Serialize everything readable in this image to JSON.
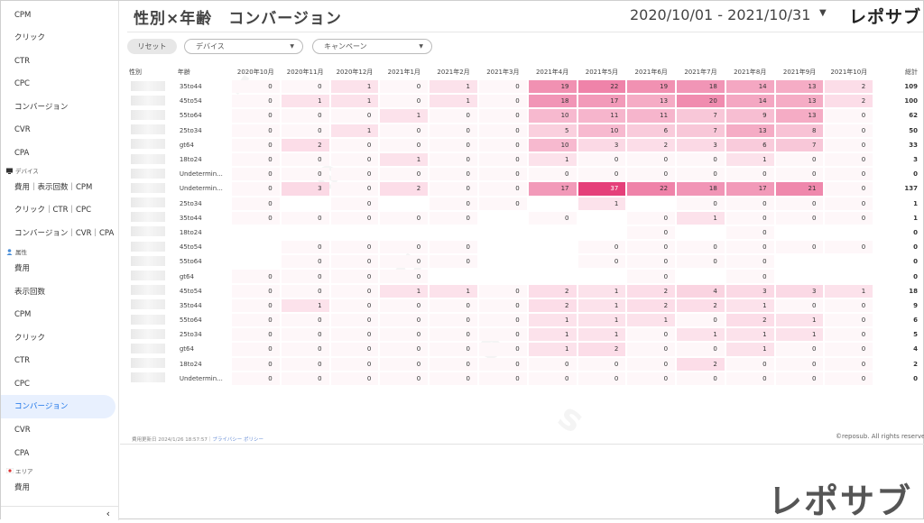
{
  "sidebar": {
    "items": [
      "CPM",
      "クリック",
      "CTR",
      "CPC",
      "コンバージョン",
      "CVR",
      "CPA"
    ],
    "device_section": "デバイス",
    "device_items": [
      "費用｜表示回数｜CPM",
      "クリック｜CTR｜CPC",
      "コンバージョン｜CVR｜CPA"
    ],
    "attr_section": "属性",
    "attr_items": [
      "費用",
      "表示回数",
      "CPM",
      "クリック",
      "CTR",
      "CPC",
      "コンバージョン",
      "CVR",
      "CPA"
    ],
    "area_section": "エリア",
    "area_items": [
      "費用"
    ],
    "collapse_label": "‹"
  },
  "header": {
    "title": "性別×年齢　コンバージョン",
    "date_range": "2020/10/01 - 2021/10/31",
    "date_caret": "▼",
    "brand": "レポサブ"
  },
  "filters": {
    "reset_label": "リセット",
    "device_label": "デバイス",
    "campaign_label": "キャンペーン",
    "caret": "▼"
  },
  "table": {
    "columns": [
      "性別",
      "年齢",
      "2020年10月",
      "2020年11月",
      "2020年12月",
      "2021年1月",
      "2021年2月",
      "2021年3月",
      "2021年4月",
      "2021年5月",
      "2021年6月",
      "2021年7月",
      "2021年8月",
      "2021年9月",
      "2021年10月",
      "総計"
    ],
    "rows": [
      {
        "age": "35to44",
        "values": [
          "0",
          "0",
          "1",
          "0",
          "1",
          "0",
          "19",
          "22",
          "19",
          "18",
          "14",
          "13",
          "2"
        ],
        "total": "109"
      },
      {
        "age": "45to54",
        "values": [
          "0",
          "1",
          "1",
          "0",
          "1",
          "0",
          "18",
          "17",
          "13",
          "20",
          "14",
          "13",
          "2"
        ],
        "total": "100"
      },
      {
        "age": "55to64",
        "values": [
          "0",
          "0",
          "0",
          "1",
          "0",
          "0",
          "10",
          "11",
          "11",
          "7",
          "9",
          "13",
          "0"
        ],
        "total": "62"
      },
      {
        "age": "25to34",
        "values": [
          "0",
          "0",
          "1",
          "0",
          "0",
          "0",
          "5",
          "10",
          "6",
          "7",
          "13",
          "8",
          "0"
        ],
        "total": "50"
      },
      {
        "age": "gt64",
        "values": [
          "0",
          "2",
          "0",
          "0",
          "0",
          "0",
          "10",
          "3",
          "2",
          "3",
          "6",
          "7",
          "0"
        ],
        "total": "33"
      },
      {
        "age": "18to24",
        "values": [
          "0",
          "0",
          "0",
          "1",
          "0",
          "0",
          "1",
          "0",
          "0",
          "0",
          "1",
          "0",
          "0"
        ],
        "total": "3"
      },
      {
        "age": "Undetermin...",
        "values": [
          "0",
          "0",
          "0",
          "0",
          "0",
          "0",
          "0",
          "0",
          "0",
          "0",
          "0",
          "0",
          "0"
        ],
        "total": "0"
      },
      {
        "age": "Undetermin...",
        "values": [
          "0",
          "3",
          "0",
          "2",
          "0",
          "0",
          "17",
          "37",
          "22",
          "18",
          "17",
          "21",
          "0"
        ],
        "total": "137"
      },
      {
        "age": "25to34",
        "values": [
          "0",
          "",
          "0",
          "",
          "0",
          "0",
          "",
          "1",
          "",
          "0",
          "0",
          "0",
          "0"
        ],
        "total": "1"
      },
      {
        "age": "35to44",
        "values": [
          "0",
          "0",
          "0",
          "0",
          "0",
          "",
          "0",
          "",
          "0",
          "1",
          "0",
          "0",
          "0"
        ],
        "total": "1"
      },
      {
        "age": "18to24",
        "values": [
          "",
          "",
          "",
          "",
          "",
          "",
          "",
          "",
          "0",
          "",
          "0",
          "",
          ""
        ],
        "total": "0"
      },
      {
        "age": "45to54",
        "values": [
          "",
          "0",
          "0",
          "0",
          "0",
          "",
          "",
          "0",
          "0",
          "0",
          "0",
          "0",
          "0"
        ],
        "total": "0"
      },
      {
        "age": "55to64",
        "values": [
          "",
          "0",
          "0",
          "0",
          "0",
          "",
          "",
          "0",
          "0",
          "0",
          "0",
          "",
          ""
        ],
        "total": "0"
      },
      {
        "age": "gt64",
        "values": [
          "0",
          "0",
          "0",
          "0",
          "",
          "",
          "",
          "",
          "0",
          "",
          "0",
          "",
          ""
        ],
        "total": "0"
      },
      {
        "age": "45to54",
        "values": [
          "0",
          "0",
          "0",
          "1",
          "1",
          "0",
          "2",
          "1",
          "2",
          "4",
          "3",
          "3",
          "1"
        ],
        "total": "18"
      },
      {
        "age": "35to44",
        "values": [
          "0",
          "1",
          "0",
          "0",
          "0",
          "0",
          "2",
          "1",
          "2",
          "2",
          "1",
          "0",
          "0"
        ],
        "total": "9"
      },
      {
        "age": "55to64",
        "values": [
          "0",
          "0",
          "0",
          "0",
          "0",
          "0",
          "1",
          "1",
          "1",
          "0",
          "2",
          "1",
          "0"
        ],
        "total": "6"
      },
      {
        "age": "25to34",
        "values": [
          "0",
          "0",
          "0",
          "0",
          "0",
          "0",
          "1",
          "1",
          "0",
          "1",
          "1",
          "1",
          "0"
        ],
        "total": "5"
      },
      {
        "age": "gt64",
        "values": [
          "0",
          "0",
          "0",
          "0",
          "0",
          "0",
          "1",
          "2",
          "0",
          "0",
          "1",
          "0",
          "0"
        ],
        "total": "4"
      },
      {
        "age": "18to24",
        "values": [
          "0",
          "0",
          "0",
          "0",
          "0",
          "0",
          "0",
          "0",
          "0",
          "2",
          "0",
          "0",
          "0"
        ],
        "total": "2"
      },
      {
        "age": "Undetermin...",
        "values": [
          "0",
          "0",
          "0",
          "0",
          "0",
          "0",
          "0",
          "0",
          "0",
          "0",
          "0",
          "0",
          "0"
        ],
        "total": "0"
      }
    ]
  },
  "footer": {
    "updated": "費用更新日 2024/1/26 18:57:57｜",
    "privacy": "プライバシー ポリシー",
    "copyright": "©reposub. All rights reserved."
  },
  "brand_large": "レポサブ",
  "colors": {
    "accent": "#e5407a",
    "active_bg": "#e8f0fe",
    "active_text": "#1a73e8"
  }
}
